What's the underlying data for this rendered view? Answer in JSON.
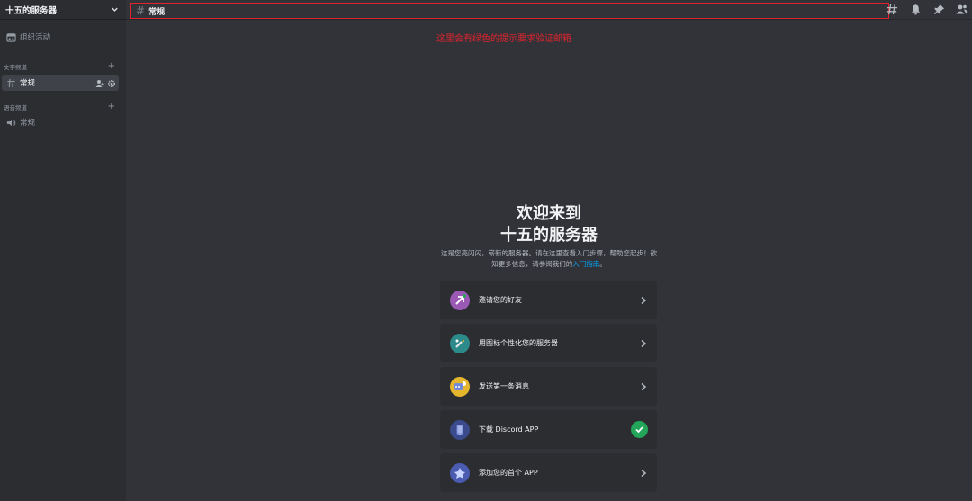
{
  "sidebar": {
    "server_name": "十五的服务器",
    "activity_label": "组织活动",
    "text_category": "文字频道",
    "voice_category": "语音频道",
    "text_channel": "常规",
    "voice_channel": "常规"
  },
  "topbar": {
    "hash": "#",
    "channel_name": "常规"
  },
  "annotation": "这里会有绿色的提示要求验证邮箱",
  "welcome": {
    "title_line1": "欢迎来到",
    "title_line2": "十五的服务器",
    "description": "这是您亮闪闪，崭新的服务器。请在这里查看入门步骤，帮助您起步！欲知更多信息，请参阅我们的",
    "link": "入门指南",
    "description_end": "。"
  },
  "cards": [
    {
      "label": "邀请您的好友",
      "icon": "invite-friends-icon",
      "done": false
    },
    {
      "label": "用图标个性化您的服务器",
      "icon": "personalize-icon",
      "done": false
    },
    {
      "label": "发送第一条消息",
      "icon": "send-message-icon",
      "done": false
    },
    {
      "label": "下载 Discord APP",
      "icon": "download-app-icon",
      "done": true
    },
    {
      "label": "添加您的首个 APP",
      "icon": "add-app-icon",
      "done": false
    }
  ],
  "colors": {
    "annotation_red": "#e0232e",
    "check_green": "#23a55a",
    "link_blue": "#00a8fc"
  }
}
